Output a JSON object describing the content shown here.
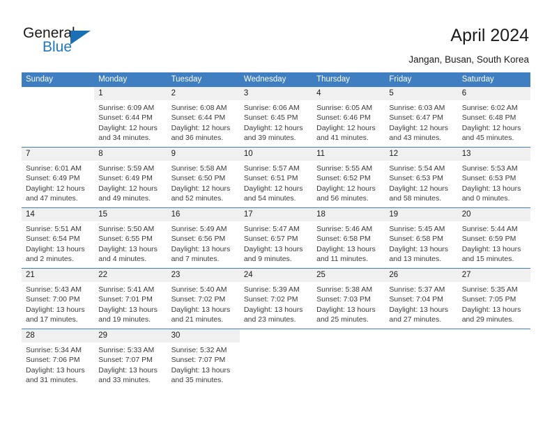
{
  "brand": {
    "name_part1": "General",
    "name_part2": "Blue",
    "logo_icon": "triangle-icon",
    "accent_color": "#2077c4"
  },
  "header": {
    "title": "April 2024",
    "location": "Jangan, Busan, South Korea"
  },
  "calendar": {
    "header_bg": "#3f7fc1",
    "day_num_bg": "#f0f0f0",
    "day_names": [
      "Sunday",
      "Monday",
      "Tuesday",
      "Wednesday",
      "Thursday",
      "Friday",
      "Saturday"
    ],
    "weeks": [
      [
        {
          "day": "",
          "sunrise": "",
          "sunset": "",
          "daylight_line1": "",
          "daylight_line2": ""
        },
        {
          "day": "1",
          "sunrise": "Sunrise: 6:09 AM",
          "sunset": "Sunset: 6:44 PM",
          "daylight_line1": "Daylight: 12 hours",
          "daylight_line2": "and 34 minutes."
        },
        {
          "day": "2",
          "sunrise": "Sunrise: 6:08 AM",
          "sunset": "Sunset: 6:44 PM",
          "daylight_line1": "Daylight: 12 hours",
          "daylight_line2": "and 36 minutes."
        },
        {
          "day": "3",
          "sunrise": "Sunrise: 6:06 AM",
          "sunset": "Sunset: 6:45 PM",
          "daylight_line1": "Daylight: 12 hours",
          "daylight_line2": "and 39 minutes."
        },
        {
          "day": "4",
          "sunrise": "Sunrise: 6:05 AM",
          "sunset": "Sunset: 6:46 PM",
          "daylight_line1": "Daylight: 12 hours",
          "daylight_line2": "and 41 minutes."
        },
        {
          "day": "5",
          "sunrise": "Sunrise: 6:03 AM",
          "sunset": "Sunset: 6:47 PM",
          "daylight_line1": "Daylight: 12 hours",
          "daylight_line2": "and 43 minutes."
        },
        {
          "day": "6",
          "sunrise": "Sunrise: 6:02 AM",
          "sunset": "Sunset: 6:48 PM",
          "daylight_line1": "Daylight: 12 hours",
          "daylight_line2": "and 45 minutes."
        }
      ],
      [
        {
          "day": "7",
          "sunrise": "Sunrise: 6:01 AM",
          "sunset": "Sunset: 6:49 PM",
          "daylight_line1": "Daylight: 12 hours",
          "daylight_line2": "and 47 minutes."
        },
        {
          "day": "8",
          "sunrise": "Sunrise: 5:59 AM",
          "sunset": "Sunset: 6:49 PM",
          "daylight_line1": "Daylight: 12 hours",
          "daylight_line2": "and 49 minutes."
        },
        {
          "day": "9",
          "sunrise": "Sunrise: 5:58 AM",
          "sunset": "Sunset: 6:50 PM",
          "daylight_line1": "Daylight: 12 hours",
          "daylight_line2": "and 52 minutes."
        },
        {
          "day": "10",
          "sunrise": "Sunrise: 5:57 AM",
          "sunset": "Sunset: 6:51 PM",
          "daylight_line1": "Daylight: 12 hours",
          "daylight_line2": "and 54 minutes."
        },
        {
          "day": "11",
          "sunrise": "Sunrise: 5:55 AM",
          "sunset": "Sunset: 6:52 PM",
          "daylight_line1": "Daylight: 12 hours",
          "daylight_line2": "and 56 minutes."
        },
        {
          "day": "12",
          "sunrise": "Sunrise: 5:54 AM",
          "sunset": "Sunset: 6:53 PM",
          "daylight_line1": "Daylight: 12 hours",
          "daylight_line2": "and 58 minutes."
        },
        {
          "day": "13",
          "sunrise": "Sunrise: 5:53 AM",
          "sunset": "Sunset: 6:53 PM",
          "daylight_line1": "Daylight: 13 hours",
          "daylight_line2": "and 0 minutes."
        }
      ],
      [
        {
          "day": "14",
          "sunrise": "Sunrise: 5:51 AM",
          "sunset": "Sunset: 6:54 PM",
          "daylight_line1": "Daylight: 13 hours",
          "daylight_line2": "and 2 minutes."
        },
        {
          "day": "15",
          "sunrise": "Sunrise: 5:50 AM",
          "sunset": "Sunset: 6:55 PM",
          "daylight_line1": "Daylight: 13 hours",
          "daylight_line2": "and 4 minutes."
        },
        {
          "day": "16",
          "sunrise": "Sunrise: 5:49 AM",
          "sunset": "Sunset: 6:56 PM",
          "daylight_line1": "Daylight: 13 hours",
          "daylight_line2": "and 7 minutes."
        },
        {
          "day": "17",
          "sunrise": "Sunrise: 5:47 AM",
          "sunset": "Sunset: 6:57 PM",
          "daylight_line1": "Daylight: 13 hours",
          "daylight_line2": "and 9 minutes."
        },
        {
          "day": "18",
          "sunrise": "Sunrise: 5:46 AM",
          "sunset": "Sunset: 6:58 PM",
          "daylight_line1": "Daylight: 13 hours",
          "daylight_line2": "and 11 minutes."
        },
        {
          "day": "19",
          "sunrise": "Sunrise: 5:45 AM",
          "sunset": "Sunset: 6:58 PM",
          "daylight_line1": "Daylight: 13 hours",
          "daylight_line2": "and 13 minutes."
        },
        {
          "day": "20",
          "sunrise": "Sunrise: 5:44 AM",
          "sunset": "Sunset: 6:59 PM",
          "daylight_line1": "Daylight: 13 hours",
          "daylight_line2": "and 15 minutes."
        }
      ],
      [
        {
          "day": "21",
          "sunrise": "Sunrise: 5:43 AM",
          "sunset": "Sunset: 7:00 PM",
          "daylight_line1": "Daylight: 13 hours",
          "daylight_line2": "and 17 minutes."
        },
        {
          "day": "22",
          "sunrise": "Sunrise: 5:41 AM",
          "sunset": "Sunset: 7:01 PM",
          "daylight_line1": "Daylight: 13 hours",
          "daylight_line2": "and 19 minutes."
        },
        {
          "day": "23",
          "sunrise": "Sunrise: 5:40 AM",
          "sunset": "Sunset: 7:02 PM",
          "daylight_line1": "Daylight: 13 hours",
          "daylight_line2": "and 21 minutes."
        },
        {
          "day": "24",
          "sunrise": "Sunrise: 5:39 AM",
          "sunset": "Sunset: 7:02 PM",
          "daylight_line1": "Daylight: 13 hours",
          "daylight_line2": "and 23 minutes."
        },
        {
          "day": "25",
          "sunrise": "Sunrise: 5:38 AM",
          "sunset": "Sunset: 7:03 PM",
          "daylight_line1": "Daylight: 13 hours",
          "daylight_line2": "and 25 minutes."
        },
        {
          "day": "26",
          "sunrise": "Sunrise: 5:37 AM",
          "sunset": "Sunset: 7:04 PM",
          "daylight_line1": "Daylight: 13 hours",
          "daylight_line2": "and 27 minutes."
        },
        {
          "day": "27",
          "sunrise": "Sunrise: 5:35 AM",
          "sunset": "Sunset: 7:05 PM",
          "daylight_line1": "Daylight: 13 hours",
          "daylight_line2": "and 29 minutes."
        }
      ],
      [
        {
          "day": "28",
          "sunrise": "Sunrise: 5:34 AM",
          "sunset": "Sunset: 7:06 PM",
          "daylight_line1": "Daylight: 13 hours",
          "daylight_line2": "and 31 minutes."
        },
        {
          "day": "29",
          "sunrise": "Sunrise: 5:33 AM",
          "sunset": "Sunset: 7:07 PM",
          "daylight_line1": "Daylight: 13 hours",
          "daylight_line2": "and 33 minutes."
        },
        {
          "day": "30",
          "sunrise": "Sunrise: 5:32 AM",
          "sunset": "Sunset: 7:07 PM",
          "daylight_line1": "Daylight: 13 hours",
          "daylight_line2": "and 35 minutes."
        },
        {
          "day": "",
          "sunrise": "",
          "sunset": "",
          "daylight_line1": "",
          "daylight_line2": ""
        },
        {
          "day": "",
          "sunrise": "",
          "sunset": "",
          "daylight_line1": "",
          "daylight_line2": ""
        },
        {
          "day": "",
          "sunrise": "",
          "sunset": "",
          "daylight_line1": "",
          "daylight_line2": ""
        },
        {
          "day": "",
          "sunrise": "",
          "sunset": "",
          "daylight_line1": "",
          "daylight_line2": ""
        }
      ]
    ]
  }
}
